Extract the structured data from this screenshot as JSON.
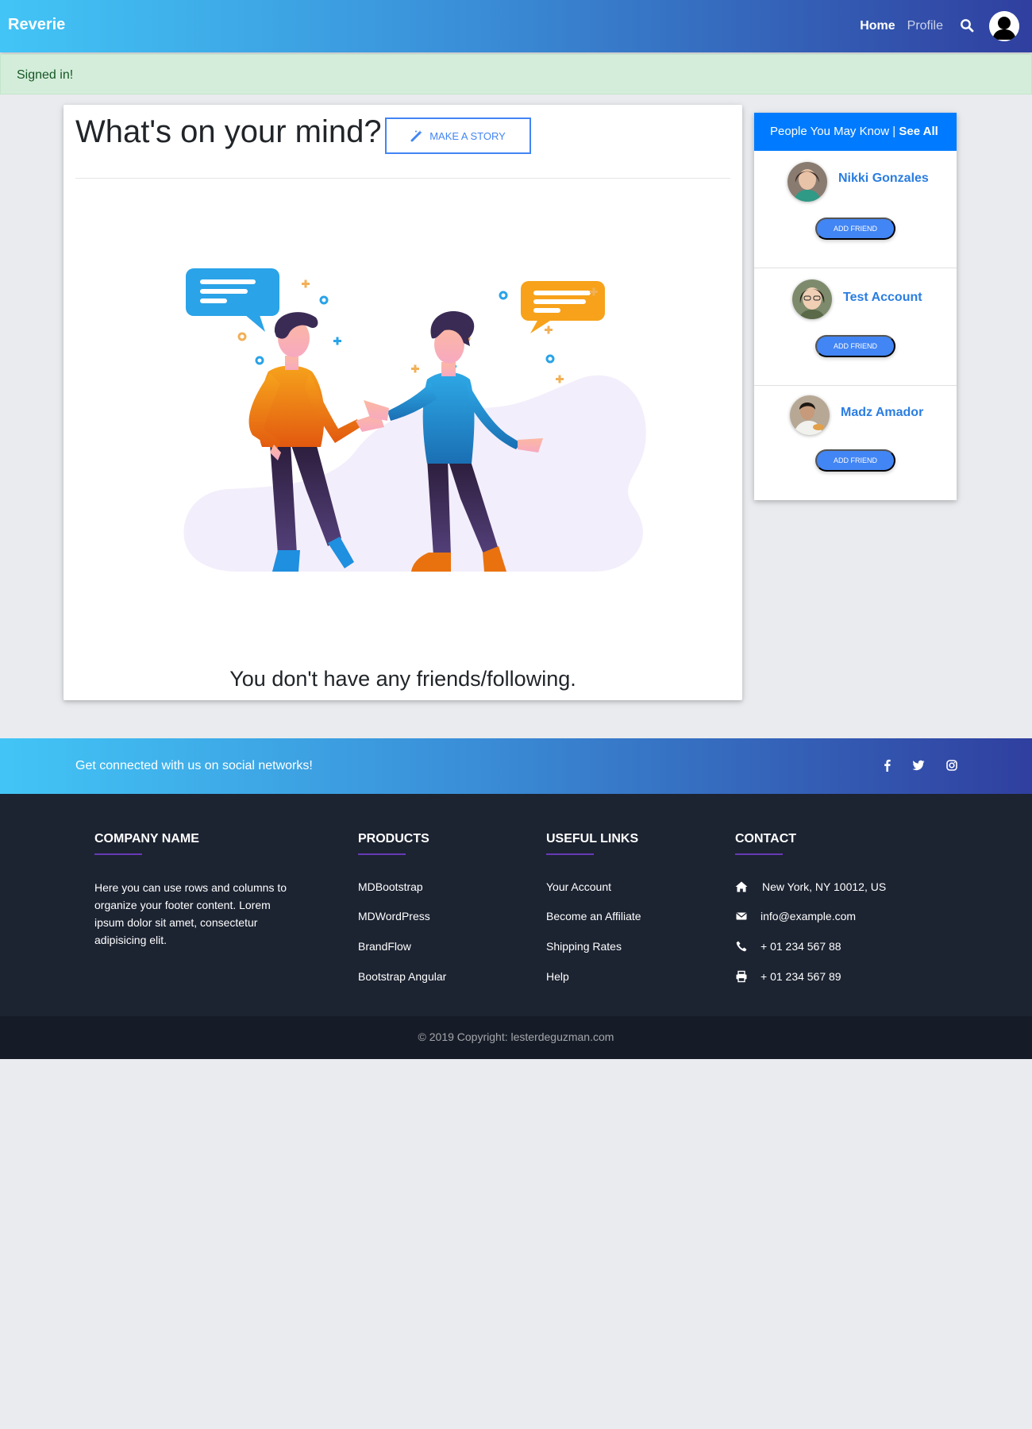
{
  "navbar": {
    "brand": "Reverie",
    "home": "Home",
    "profile": "Profile",
    "search_icon": "search-icon",
    "avatar_icon": "user-avatar-icon"
  },
  "alert": {
    "message": "Signed in!"
  },
  "main": {
    "title": "What's on your mind?",
    "story_button": "MAKE A STORY",
    "story_icon": "magic-wand-icon",
    "empty_message": "You don't have any friends/following."
  },
  "suggestions": {
    "header": "People You May Know | ",
    "see_all": "See All",
    "people": [
      {
        "name": "Nikki Gonzales",
        "button": "ADD FRIEND"
      },
      {
        "name": "Test Account",
        "button": "ADD FRIEND"
      },
      {
        "name": "Madz Amador",
        "button": "ADD FRIEND"
      }
    ]
  },
  "social": {
    "text": "Get connected with us on social networks!",
    "icons": [
      "facebook-icon",
      "twitter-icon",
      "instagram-icon"
    ]
  },
  "footer": {
    "company": {
      "heading": "COMPANY NAME",
      "text": "Here you can use rows and columns to organize your footer content. Lorem ipsum dolor sit amet, consectetur adipisicing elit."
    },
    "products": {
      "heading": "PRODUCTS",
      "links": [
        "MDBootstrap",
        "MDWordPress",
        "BrandFlow",
        "Bootstrap Angular"
      ]
    },
    "useful": {
      "heading": "USEFUL LINKS",
      "links": [
        "Your Account",
        "Become an Affiliate",
        "Shipping Rates",
        "Help"
      ]
    },
    "contact": {
      "heading": "CONTACT",
      "address": "New York, NY 10012, US",
      "email": "info@example.com",
      "phone": "+ 01 234 567 88",
      "fax": "+ 01 234 567 89"
    }
  },
  "copyright": {
    "text": "© 2019 Copyright: ",
    "link": "lesterdeguzman.com"
  },
  "colors": {
    "primary": "#4285f4",
    "header_blue": "#007bff",
    "footer_dark": "#1c2331",
    "alert_green": "#d4edda"
  }
}
